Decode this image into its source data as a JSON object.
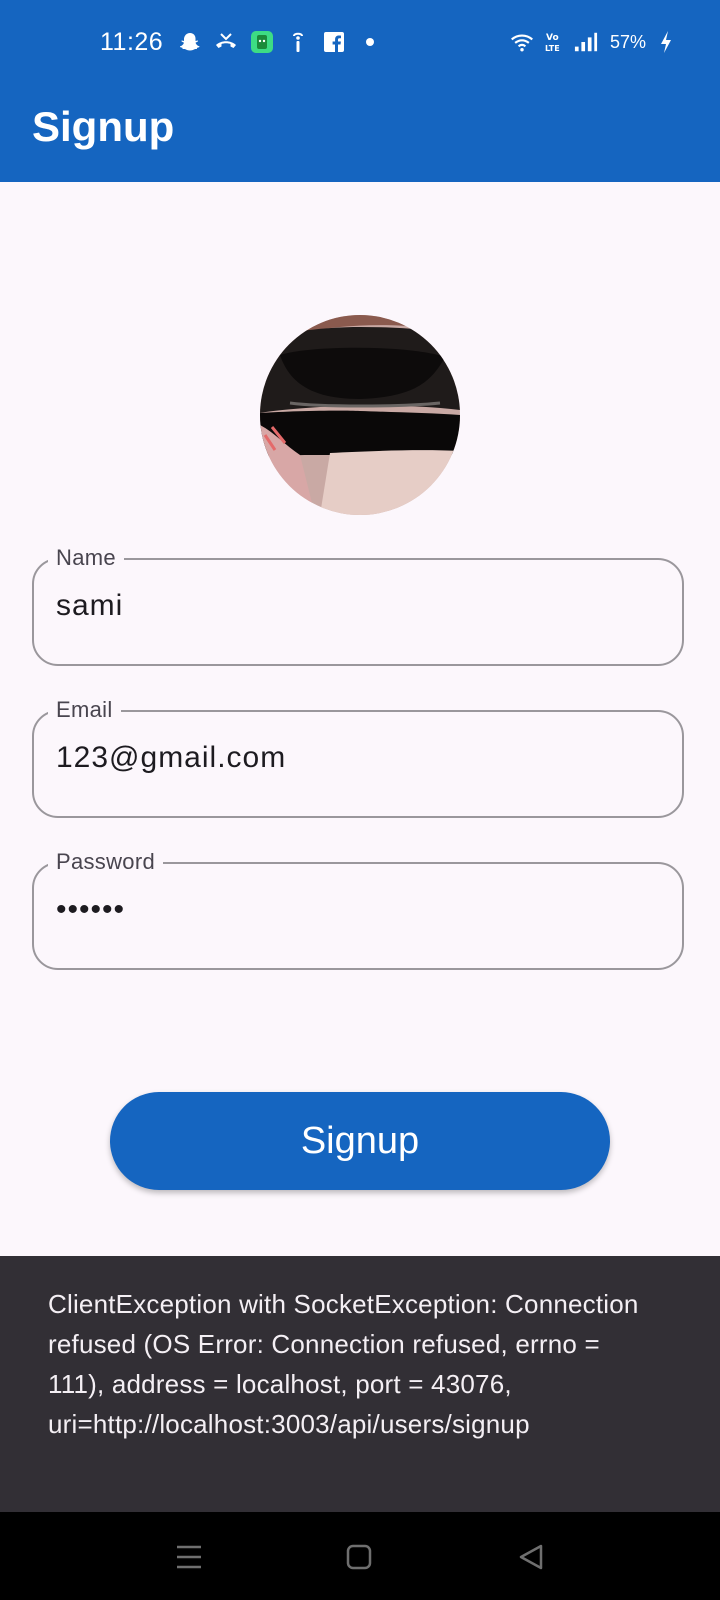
{
  "status_bar": {
    "time": "11:26",
    "battery": "57%",
    "left_icons": [
      "snapchat-icon",
      "missed-call-icon",
      "app-notification-icon",
      "info-icon",
      "facebook-icon",
      "dot-icon"
    ],
    "right_icons": [
      "wifi-icon",
      "volte-icon",
      "signal-icon",
      "battery-charging-icon"
    ]
  },
  "app_bar": {
    "title": "Signup"
  },
  "form": {
    "name": {
      "label": "Name",
      "value": "sami"
    },
    "email": {
      "label": "Email",
      "value": "123@gmail.com"
    },
    "password": {
      "label": "Password",
      "value": "••••••"
    }
  },
  "signup_button": {
    "label": "Signup"
  },
  "snackbar": {
    "message": "ClientException with SocketException: Connection refused (OS Error: Connection refused, errno = 111), address = localhost, port = 43076, uri=http://localhost:3003/api/users/signup"
  },
  "nav_bar": {
    "buttons": [
      "menu-icon",
      "home-square-icon",
      "back-triangle-icon"
    ]
  },
  "colors": {
    "primary": "#1565c0",
    "background": "#fcf7fc",
    "snackbar": "#322f35",
    "outline": "#9a979c"
  }
}
